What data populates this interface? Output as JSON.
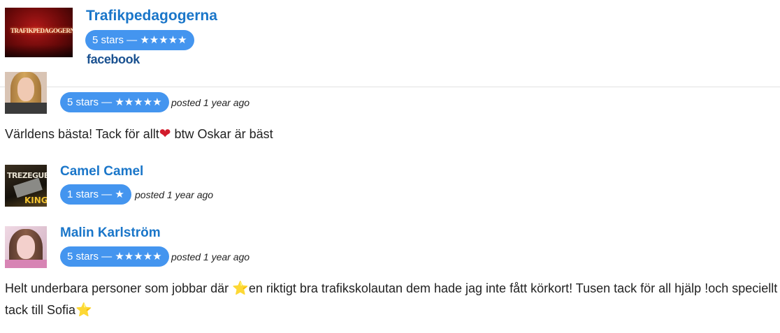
{
  "page": {
    "name": "Trafikpedagogerna",
    "rating_label": "5 stars — ★★★★★",
    "source_label": "facebook",
    "logo_text": "TRAFIKPEDAGOGERNA"
  },
  "reviews": [
    {
      "name": "",
      "rating_label": "5 stars — ★★★★★",
      "posted": "posted 1 year ago",
      "text_before": "Världens bästa! Tack för allt",
      "text_emoji": "❤",
      "text_after": " btw Oskar är bäst"
    },
    {
      "name": "Camel Camel",
      "rating_label": "1 stars — ★",
      "posted": "posted 1 year ago",
      "avatar_text_top": "TREZEGUET",
      "avatar_text_bottom": "KING"
    },
    {
      "name": "Malin Karlström",
      "rating_label": "5 stars — ★★★★★",
      "posted": "posted 1 year ago",
      "text_part1": "Helt underbara personer som jobbar där ",
      "text_part2": "en riktigt bra trafikskolautan dem hade jag inte fått körkort! Tusen tack för all hjälp !och speciellt tack till Sofia",
      "text_emoji": "⭐"
    }
  ],
  "colors": {
    "accent": "#1a76c9",
    "badge": "#4495ef",
    "facebook": "#1a5190",
    "heart": "#d21c2c",
    "star": "#f6a623"
  }
}
